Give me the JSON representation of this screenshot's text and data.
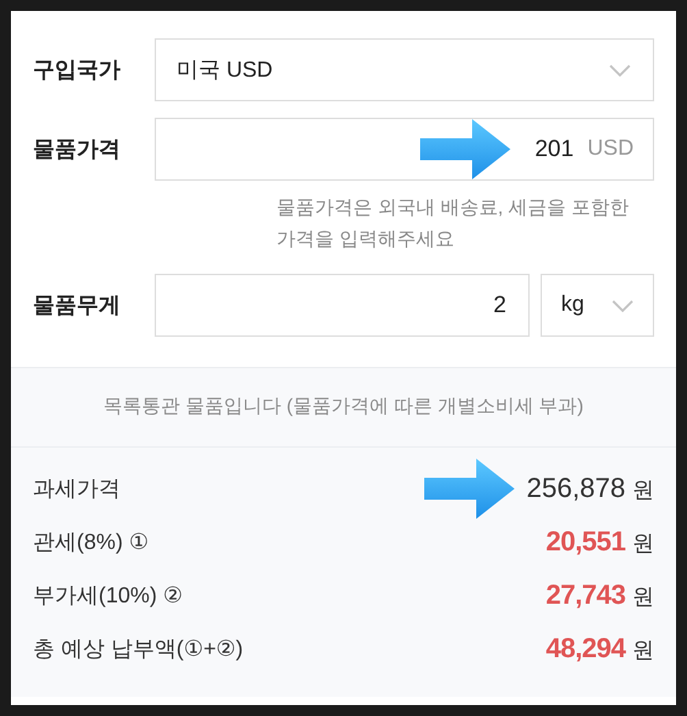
{
  "form": {
    "country": {
      "label": "구입국가",
      "value": "미국 USD"
    },
    "price": {
      "label": "물품가격",
      "value": "201",
      "unit": "USD",
      "arrow": true,
      "hint": "물품가격은 외국내 배송료, 세금을 포함한 가격을 입력해주세요"
    },
    "weight": {
      "label": "물품무게",
      "value": "2",
      "unit": "kg"
    }
  },
  "notice": "목록통관 물품입니다 (물품가격에 따른 개별소비세 부과)",
  "results": [
    {
      "label": "과세가격",
      "amount": "256,878",
      "currency": "원",
      "kind": "base",
      "arrow": true
    },
    {
      "label": "관세(8%) ①",
      "amount": "20,551",
      "currency": "원",
      "kind": "tax",
      "arrow": false
    },
    {
      "label": "부가세(10%) ②",
      "amount": "27,743",
      "currency": "원",
      "kind": "tax",
      "arrow": false
    },
    {
      "label": "총 예상 납부액(①+②)",
      "amount": "48,294",
      "currency": "원",
      "kind": "tax",
      "arrow": false
    }
  ]
}
